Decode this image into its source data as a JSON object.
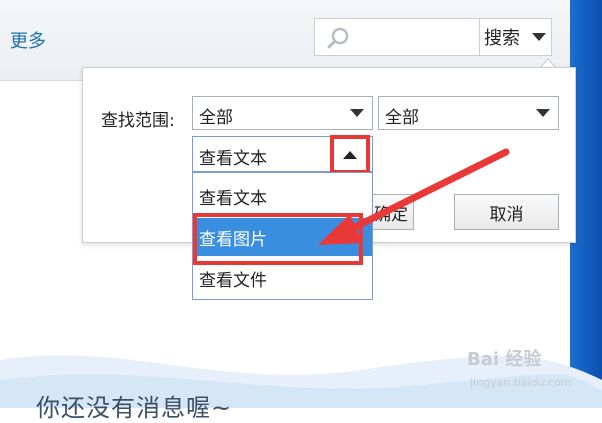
{
  "header": {
    "more_link": "更多",
    "search": {
      "placeholder": "",
      "button_label": "搜索"
    }
  },
  "popup": {
    "scope_label": "查找范围:",
    "scope_select_1": "全部",
    "scope_select_2": "全部",
    "view_select": "查看文本",
    "dropdown_options": [
      "查看文本",
      "查看图片",
      "查看文件"
    ],
    "selected_option": "查看图片",
    "ok_label": "确定",
    "cancel_label": "取消"
  },
  "background": {
    "empty_message": "你还没有消息喔~",
    "watermark": "Bai 经验",
    "watermark_url": "jingyan.baidu.com"
  },
  "colors": {
    "annotation": "#e83838",
    "selected": "#3a8ee0",
    "link": "#1f6fb5"
  }
}
